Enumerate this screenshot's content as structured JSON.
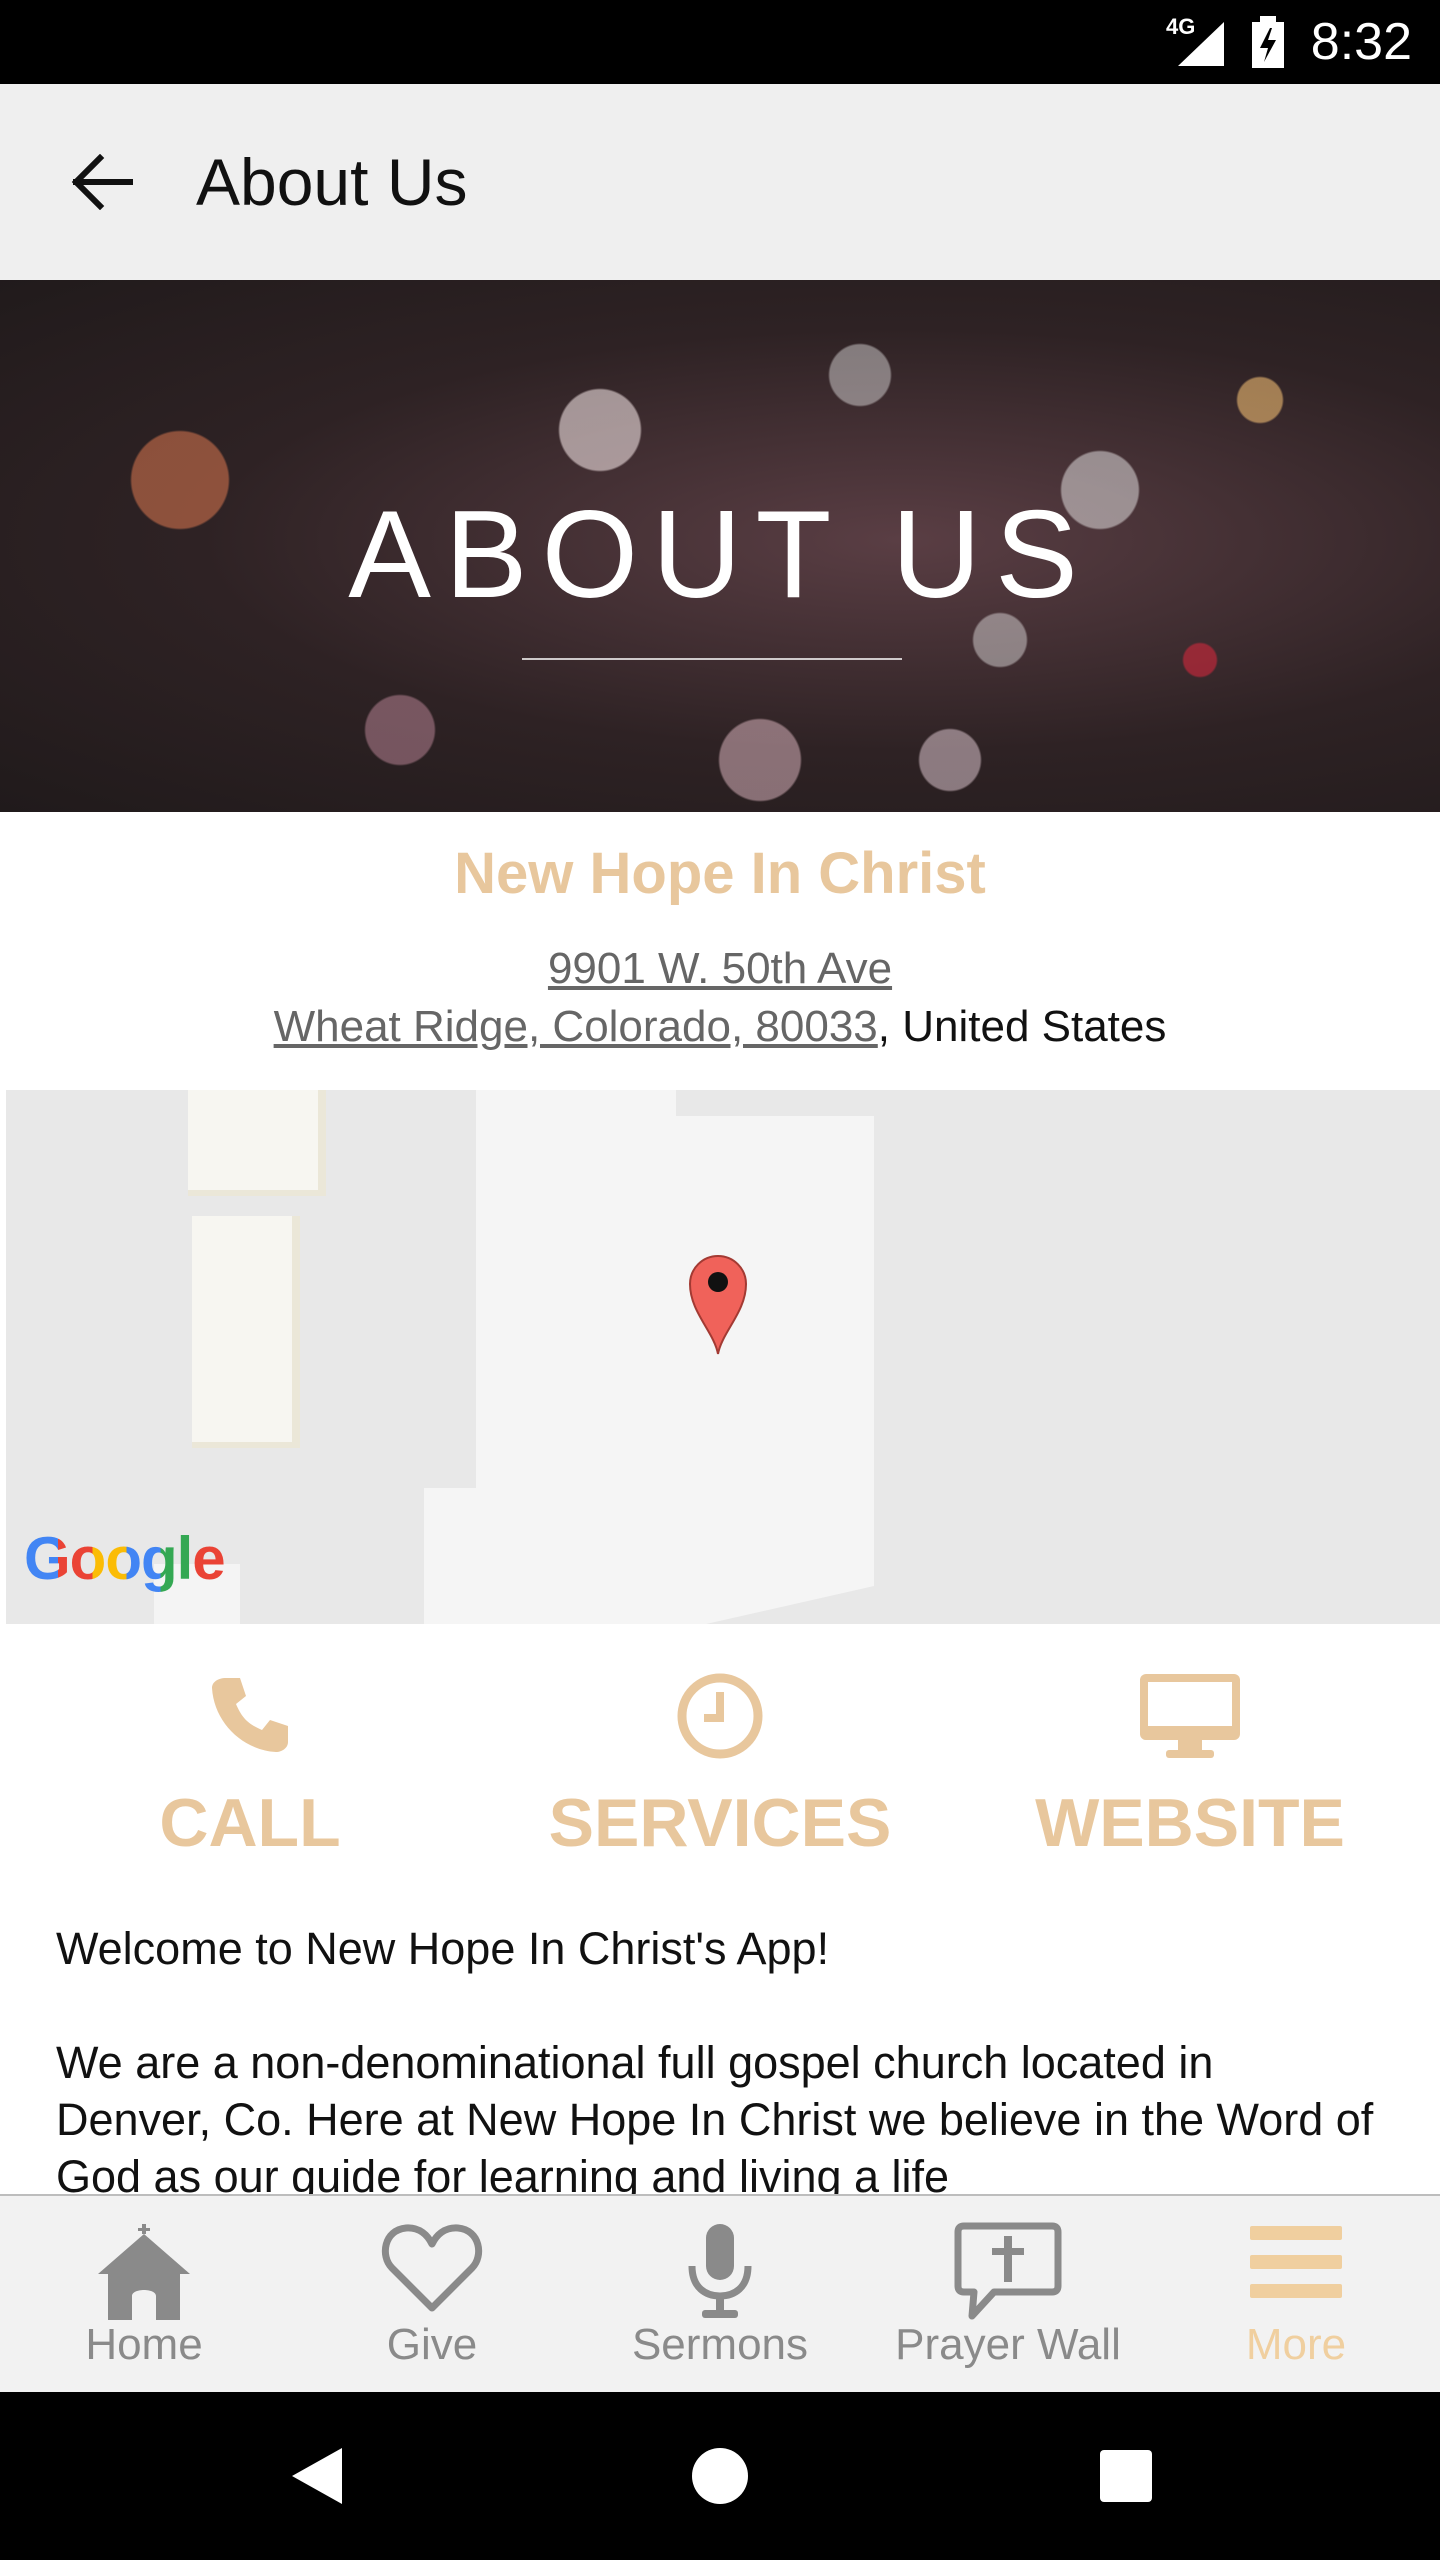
{
  "status_bar": {
    "time": "8:32",
    "network": "4G"
  },
  "header": {
    "title": "About Us"
  },
  "banner": {
    "heading": "ABOUT US"
  },
  "church": {
    "name": "New Hope In Christ",
    "street": "9901 W. 50th Ave",
    "city_line": "Wheat Ridge, Colorado, 80033",
    "country": ", United States"
  },
  "map": {
    "logo": "Google",
    "marker_icon": "map-pin-icon"
  },
  "actions": [
    {
      "label": "CALL",
      "icon": "phone-icon"
    },
    {
      "label": "SERVICES",
      "icon": "clock-icon"
    },
    {
      "label": "WEBSITE",
      "icon": "monitor-icon"
    }
  ],
  "body": {
    "welcome": "Welcome to New Hope In Christ's App!",
    "paragraph": "We are a non-denominational full gospel church located in Denver, Co. Here at New Hope In Christ we believe in the Word of God as our guide for learning and living a life"
  },
  "bottom_nav": [
    {
      "label": "Home",
      "icon": "church-icon"
    },
    {
      "label": "Give",
      "icon": "heart-icon"
    },
    {
      "label": "Sermons",
      "icon": "microphone-icon"
    },
    {
      "label": "Prayer Wall",
      "icon": "speech-bubble-cross-icon"
    },
    {
      "label": "More",
      "icon": "menu-icon",
      "active": true
    }
  ],
  "colors": {
    "accent": "#e8c79d",
    "nav_active": "#f0cf9f",
    "nav_inactive": "#8a8a8a",
    "marker": "#f0625a"
  }
}
